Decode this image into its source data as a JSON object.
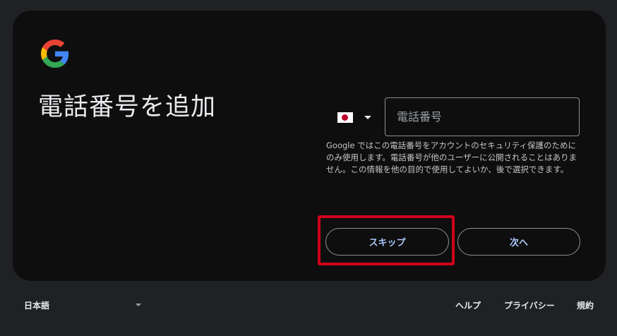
{
  "card": {
    "title": "電話番号を追加",
    "phone_placeholder": "電話番号",
    "country_flag_icon": "japan-flag-icon",
    "help_text": "Google ではこの電話番号をアカウントのセキュリティ保護のためにのみ使用します。電話番号が他のユーザーに公開されることはありません。この情報を他の目的で使用してよいか、後で選択できます。",
    "skip_label": "スキップ",
    "next_label": "次へ"
  },
  "footer": {
    "language": "日本語",
    "links": {
      "help": "ヘルプ",
      "privacy": "プライバシー",
      "terms": "規約"
    }
  },
  "colors": {
    "page_bg": "#202124",
    "card_bg": "#0e0e0e",
    "button_text": "#a8c7fa",
    "highlight": "#d0021b"
  }
}
